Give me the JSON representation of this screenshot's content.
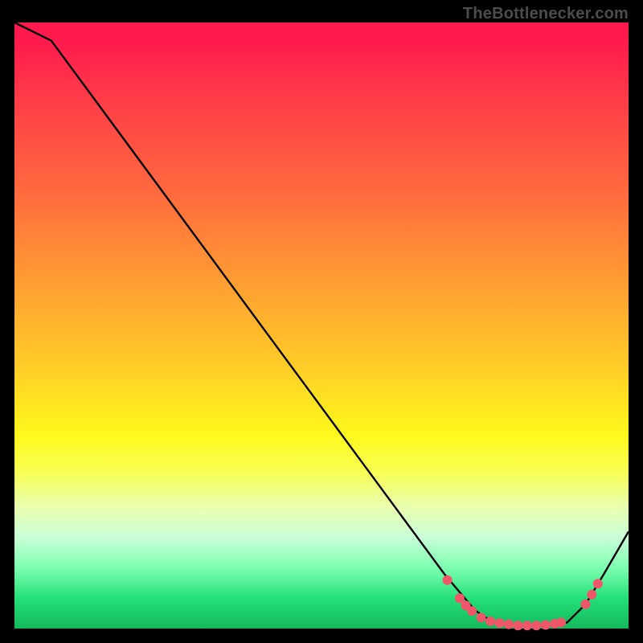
{
  "attribution": "TheBottlenecker.com",
  "colors": {
    "curve_stroke": "#000000",
    "marker_fill": "#ef566a",
    "marker_stroke": "#ef566a",
    "frame_bg": "#000000"
  },
  "chart_data": {
    "type": "line",
    "title": "",
    "xlabel": "",
    "ylabel": "",
    "xlim": [
      0,
      100
    ],
    "ylim": [
      0,
      100
    ],
    "x": [
      0,
      6,
      14,
      22,
      30,
      38,
      46,
      54,
      62,
      70,
      75,
      78,
      82,
      86,
      90,
      93,
      96,
      100
    ],
    "y": [
      100,
      97,
      86,
      75,
      64,
      53,
      42,
      31,
      20,
      9,
      3,
      1,
      0.5,
      0.5,
      1,
      4,
      9,
      16
    ],
    "series": [
      {
        "name": "bottleneck-curve",
        "x": [
          0,
          6,
          14,
          22,
          30,
          38,
          46,
          54,
          62,
          70,
          75,
          78,
          82,
          86,
          90,
          93,
          96,
          100
        ],
        "y": [
          100,
          97,
          86,
          75,
          64,
          53,
          42,
          31,
          20,
          9,
          3,
          1,
          0.5,
          0.5,
          1,
          4,
          9,
          16
        ]
      }
    ],
    "markers": [
      {
        "x": 70.5,
        "y": 8.0
      },
      {
        "x": 72.5,
        "y": 5.0
      },
      {
        "x": 73.5,
        "y": 3.8
      },
      {
        "x": 74.5,
        "y": 2.9
      },
      {
        "x": 76.0,
        "y": 1.8
      },
      {
        "x": 77.5,
        "y": 1.2
      },
      {
        "x": 79.0,
        "y": 0.9
      },
      {
        "x": 80.5,
        "y": 0.7
      },
      {
        "x": 82.0,
        "y": 0.5
      },
      {
        "x": 83.5,
        "y": 0.5
      },
      {
        "x": 85.0,
        "y": 0.5
      },
      {
        "x": 86.5,
        "y": 0.6
      },
      {
        "x": 88.0,
        "y": 0.8
      },
      {
        "x": 89.0,
        "y": 1.0
      },
      {
        "x": 93.0,
        "y": 4.0
      },
      {
        "x": 94.0,
        "y": 5.6
      },
      {
        "x": 95.0,
        "y": 7.4
      }
    ]
  }
}
